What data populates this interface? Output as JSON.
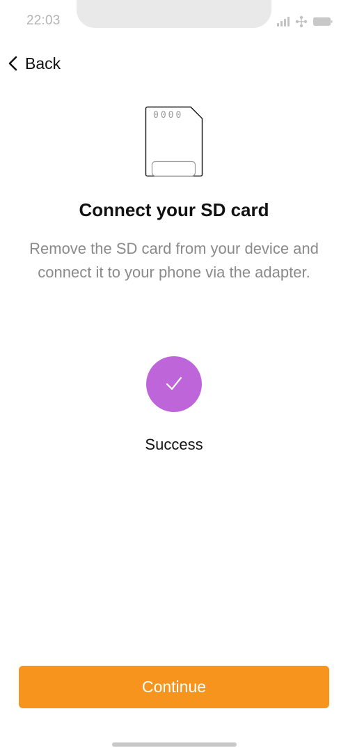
{
  "status_bar": {
    "time": "22:03",
    "icons": [
      "signal-icon",
      "wifi-icon",
      "battery-icon"
    ]
  },
  "nav": {
    "back_label": "Back",
    "back_icon": "chevron-left-icon"
  },
  "illustration": {
    "icon": "sd-card-icon",
    "card_label": "0000"
  },
  "content": {
    "title": "Connect your SD card",
    "description": "Remove the SD card from your device and connect it to your phone via the adapter."
  },
  "status": {
    "icon": "checkmark-icon",
    "label": "Success",
    "color": "#bd65d9"
  },
  "actions": {
    "continue_label": "Continue",
    "continue_color": "#f6941d"
  }
}
